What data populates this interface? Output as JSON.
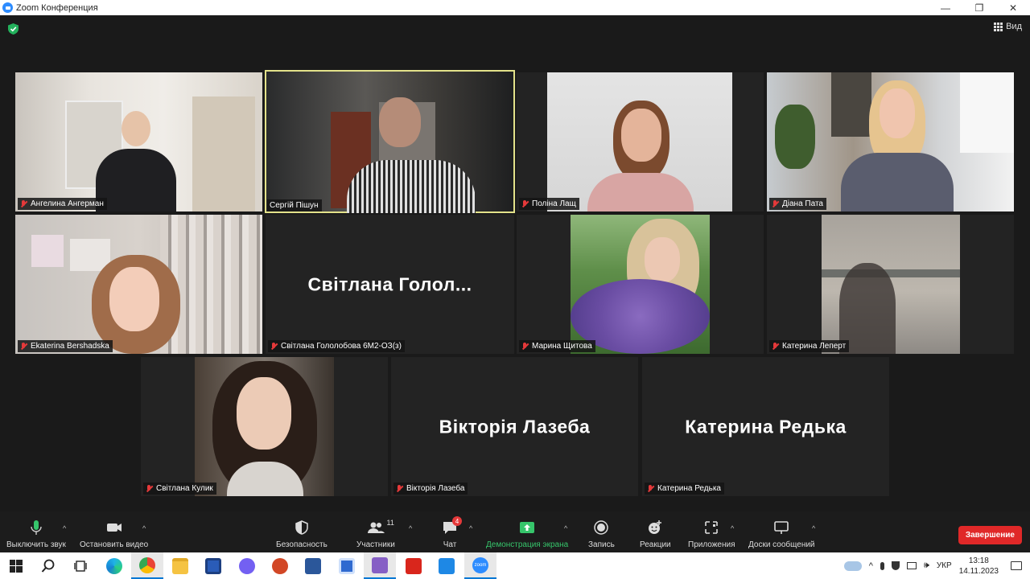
{
  "window": {
    "title": "Zoom Конференция",
    "min_glyph": "—",
    "max_glyph": "❐",
    "close_glyph": "✕"
  },
  "header": {
    "view_label": "Вид"
  },
  "participants": [
    {
      "name": "Ангелина Ангерман",
      "video": true,
      "muted": true
    },
    {
      "name": "Сергій Пішун",
      "video": true,
      "muted": false,
      "active_speaker": true
    },
    {
      "name": "Поліна Лащ",
      "video": true,
      "muted": true
    },
    {
      "name": "Діана Пата",
      "video": true,
      "muted": true
    },
    {
      "name": "Ekaterina Bershadska",
      "video": true,
      "muted": true
    },
    {
      "name": "Світлана Гололобова 6М2-ОЗ(з)",
      "display_name": "Світлана  Голол...",
      "video": false,
      "muted": true
    },
    {
      "name": "Марина Щитова",
      "video": true,
      "muted": true
    },
    {
      "name": "Катерина Леперт",
      "video": true,
      "muted": true
    },
    {
      "name": "Світлана Кулик",
      "video": true,
      "muted": true
    },
    {
      "name": "Вікторія Лазеба",
      "display_name": "Вікторія Лазеба",
      "video": false,
      "muted": true
    },
    {
      "name": "Катерина Редька",
      "display_name": "Катерина Редька",
      "video": false,
      "muted": true
    }
  ],
  "toolbar": {
    "mute_label": "Выключить звук",
    "video_label": "Остановить видео",
    "security_label": "Безопасность",
    "participants_label": "Участники",
    "participants_count": "11",
    "chat_label": "Чат",
    "chat_badge": "4",
    "share_label": "Демонстрация экрана",
    "record_label": "Запись",
    "reactions_label": "Реакции",
    "apps_label": "Приложения",
    "whiteboard_label": "Доски сообщений",
    "end_label": "Завершение",
    "caret": "^"
  },
  "taskbar": {
    "lang": "УКР",
    "time": "13:18",
    "date": "14.11.2023",
    "zoom_label": "zoom"
  },
  "colors": {
    "accent": "#2d8cff",
    "active_speaker": "#e3e28a",
    "end": "#e02828",
    "share_green": "#36c56b"
  }
}
